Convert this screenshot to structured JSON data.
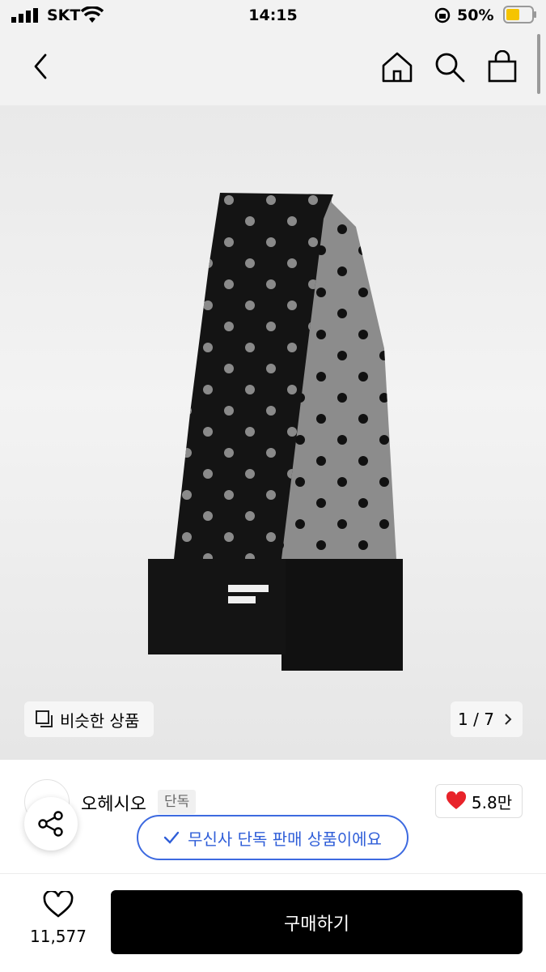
{
  "status_bar": {
    "carrier": "SKT",
    "time": "14:15",
    "battery": "50%"
  },
  "product": {
    "similar_label": "비슷한 상품",
    "page_indicator": "1 / 7"
  },
  "brand": {
    "name": "오헤시오",
    "badge": "단독",
    "likes": "5.8만"
  },
  "toast": {
    "text": "무신사 단독 판매 상품이에요"
  },
  "bottom": {
    "wish_count": "11,577",
    "buy_label": "구매하기"
  },
  "colors": {
    "accent": "#2f5ed8",
    "heart": "#e8232a",
    "buy_button": "#000000"
  }
}
